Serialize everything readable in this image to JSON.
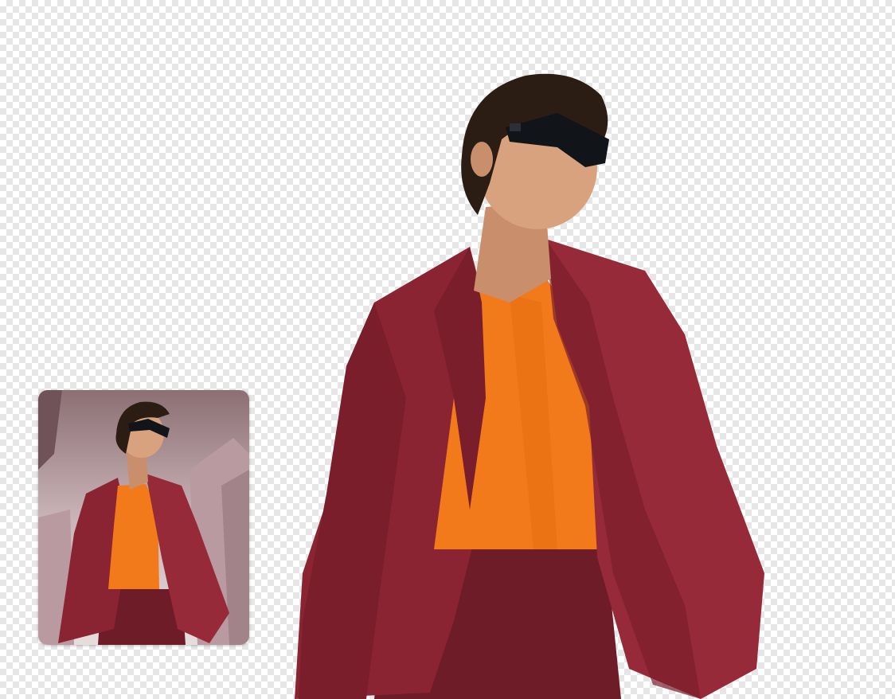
{
  "canvas": {
    "background": "transparency-checkerboard",
    "checker_colors": [
      "#ffffff",
      "#e6e6e6"
    ]
  },
  "subject": {
    "description_icon": "person-cutout",
    "colors": {
      "suit": "#8a2432",
      "suit_shadow": "#5e1520",
      "shirt": "#f27a1a",
      "skin": "#d9a27e",
      "hair": "#2b1c14",
      "sunglasses": "#111418"
    }
  },
  "original_thumbnail": {
    "sky_colors": [
      "#8b6f73",
      "#c9b3b6",
      "#e8dcdc"
    ],
    "building_color": "#b89aa0"
  }
}
